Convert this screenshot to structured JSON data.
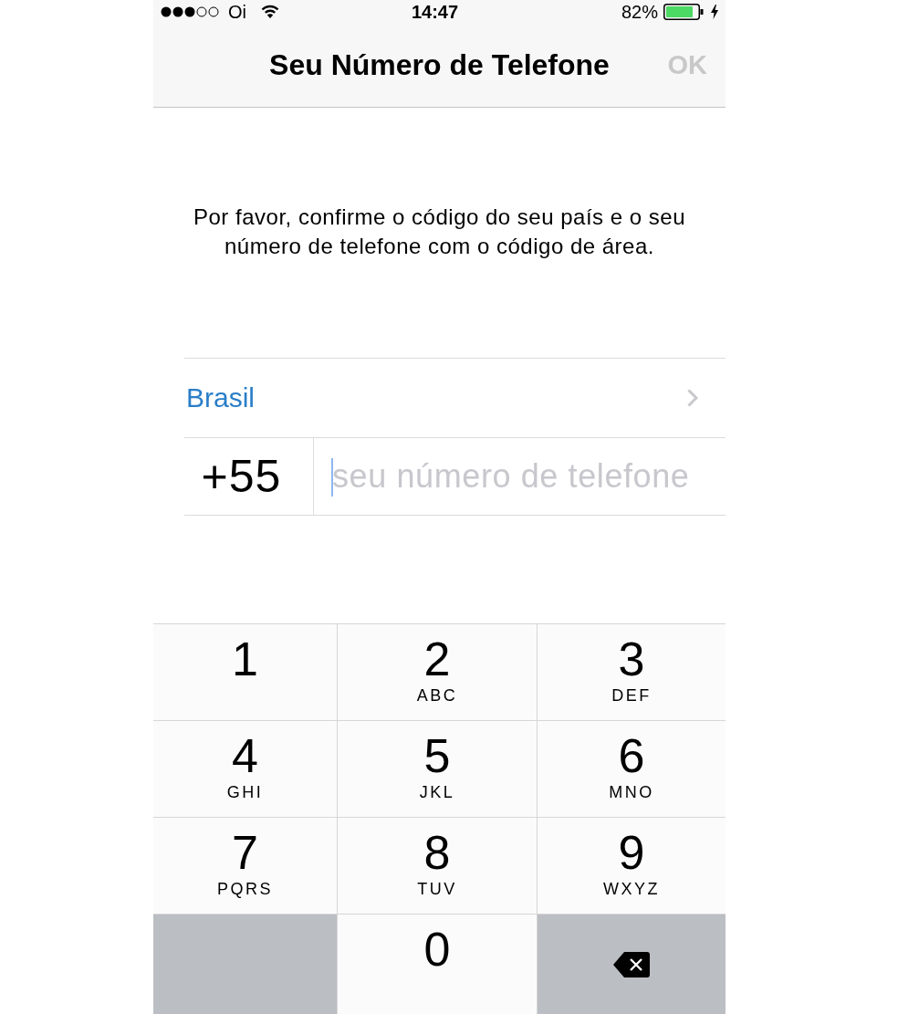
{
  "status_bar": {
    "carrier": "Oi",
    "time": "14:47",
    "battery": "82%",
    "charging": true
  },
  "nav_bar": {
    "title": "Seu Número de Telefone",
    "action": {
      "label": "OK",
      "disabled": true
    }
  },
  "instructions": "Por favor, confirme o código do seu país e o seu número de telefone com o código de área.",
  "country_row": {
    "country": "Brasil"
  },
  "phone_row": {
    "country_code": "+55",
    "placeholder": "seu número de telefone",
    "focused": true
  },
  "keypad": {
    "keys": [
      {
        "kind": "digit",
        "digit": "1"
      },
      {
        "kind": "digit",
        "digit": "2",
        "letters": "ABC"
      },
      {
        "kind": "digit",
        "digit": "3",
        "letters": "DEF"
      },
      {
        "kind": "digit",
        "digit": "4",
        "letters": "GHI"
      },
      {
        "kind": "digit",
        "digit": "5",
        "letters": "JKL"
      },
      {
        "kind": "digit",
        "digit": "6",
        "letters": "MNO"
      },
      {
        "kind": "digit",
        "digit": "7",
        "letters": "PQRS"
      },
      {
        "kind": "digit",
        "digit": "8",
        "letters": "TUV"
      },
      {
        "kind": "digit",
        "digit": "9",
        "letters": "WXYZ"
      },
      {
        "kind": "blank"
      },
      {
        "kind": "digit",
        "digit": "0"
      },
      {
        "kind": "delete"
      }
    ]
  }
}
